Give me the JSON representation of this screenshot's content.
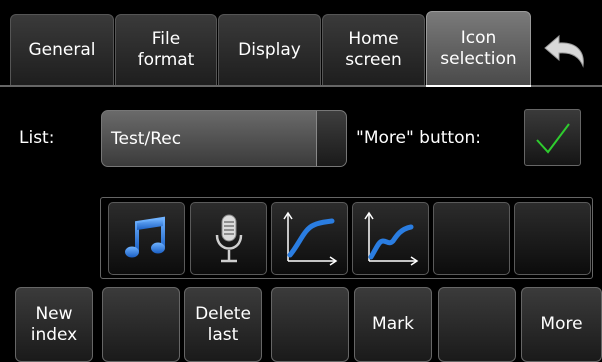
{
  "tabs": [
    {
      "label": "General"
    },
    {
      "label": "File\nformat"
    },
    {
      "label": "Display"
    },
    {
      "label": "Home\nscreen"
    },
    {
      "label": "Icon\nselection",
      "active": true
    }
  ],
  "back": {
    "icon": "undo-arrow-icon"
  },
  "list": {
    "label": "List:",
    "value": "Test/Rec"
  },
  "more_button": {
    "label": "\"More\" button:",
    "checked": true,
    "check_color": "#2ecc2e"
  },
  "icons": [
    {
      "name": "music-note-icon",
      "color": "#2a7de1"
    },
    {
      "name": "microphone-icon",
      "color": "#cfcfcf"
    },
    {
      "name": "curve-smooth-icon",
      "color": "#2a7de1"
    },
    {
      "name": "curve-stepped-icon",
      "color": "#2a7de1"
    },
    {
      "name": "empty-slot"
    },
    {
      "name": "empty-slot"
    }
  ],
  "bottom_buttons": [
    {
      "label": "New\nindex"
    },
    {
      "label": ""
    },
    {
      "label": "Delete\nlast"
    },
    {
      "label": ""
    },
    {
      "label": "Mark"
    },
    {
      "label": ""
    },
    {
      "label": "More"
    }
  ],
  "colors": {
    "accent_blue": "#2a7de1",
    "check_green": "#2ecc2e"
  }
}
